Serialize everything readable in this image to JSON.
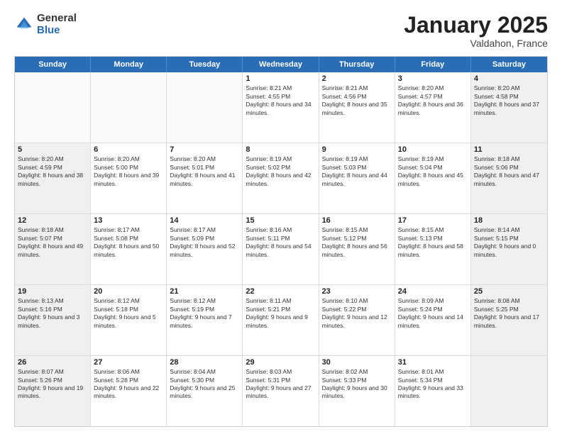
{
  "logo": {
    "general": "General",
    "blue": "Blue"
  },
  "header": {
    "month": "January 2025",
    "location": "Valdahon, France"
  },
  "weekdays": [
    "Sunday",
    "Monday",
    "Tuesday",
    "Wednesday",
    "Thursday",
    "Friday",
    "Saturday"
  ],
  "rows": [
    [
      {
        "day": "",
        "sunrise": "",
        "sunset": "",
        "daylight": "",
        "shaded": false,
        "empty": true
      },
      {
        "day": "",
        "sunrise": "",
        "sunset": "",
        "daylight": "",
        "shaded": false,
        "empty": true
      },
      {
        "day": "",
        "sunrise": "",
        "sunset": "",
        "daylight": "",
        "shaded": false,
        "empty": true
      },
      {
        "day": "1",
        "sunrise": "Sunrise: 8:21 AM",
        "sunset": "Sunset: 4:55 PM",
        "daylight": "Daylight: 8 hours and 34 minutes.",
        "shaded": false,
        "empty": false
      },
      {
        "day": "2",
        "sunrise": "Sunrise: 8:21 AM",
        "sunset": "Sunset: 4:56 PM",
        "daylight": "Daylight: 8 hours and 35 minutes.",
        "shaded": false,
        "empty": false
      },
      {
        "day": "3",
        "sunrise": "Sunrise: 8:20 AM",
        "sunset": "Sunset: 4:57 PM",
        "daylight": "Daylight: 8 hours and 36 minutes.",
        "shaded": false,
        "empty": false
      },
      {
        "day": "4",
        "sunrise": "Sunrise: 8:20 AM",
        "sunset": "Sunset: 4:58 PM",
        "daylight": "Daylight: 8 hours and 37 minutes.",
        "shaded": true,
        "empty": false
      }
    ],
    [
      {
        "day": "5",
        "sunrise": "Sunrise: 8:20 AM",
        "sunset": "Sunset: 4:59 PM",
        "daylight": "Daylight: 8 hours and 38 minutes.",
        "shaded": true,
        "empty": false
      },
      {
        "day": "6",
        "sunrise": "Sunrise: 8:20 AM",
        "sunset": "Sunset: 5:00 PM",
        "daylight": "Daylight: 8 hours and 39 minutes.",
        "shaded": false,
        "empty": false
      },
      {
        "day": "7",
        "sunrise": "Sunrise: 8:20 AM",
        "sunset": "Sunset: 5:01 PM",
        "daylight": "Daylight: 8 hours and 41 minutes.",
        "shaded": false,
        "empty": false
      },
      {
        "day": "8",
        "sunrise": "Sunrise: 8:19 AM",
        "sunset": "Sunset: 5:02 PM",
        "daylight": "Daylight: 8 hours and 42 minutes.",
        "shaded": false,
        "empty": false
      },
      {
        "day": "9",
        "sunrise": "Sunrise: 8:19 AM",
        "sunset": "Sunset: 5:03 PM",
        "daylight": "Daylight: 8 hours and 44 minutes.",
        "shaded": false,
        "empty": false
      },
      {
        "day": "10",
        "sunrise": "Sunrise: 8:19 AM",
        "sunset": "Sunset: 5:04 PM",
        "daylight": "Daylight: 8 hours and 45 minutes.",
        "shaded": false,
        "empty": false
      },
      {
        "day": "11",
        "sunrise": "Sunrise: 8:18 AM",
        "sunset": "Sunset: 5:06 PM",
        "daylight": "Daylight: 8 hours and 47 minutes.",
        "shaded": true,
        "empty": false
      }
    ],
    [
      {
        "day": "12",
        "sunrise": "Sunrise: 8:18 AM",
        "sunset": "Sunset: 5:07 PM",
        "daylight": "Daylight: 8 hours and 49 minutes.",
        "shaded": true,
        "empty": false
      },
      {
        "day": "13",
        "sunrise": "Sunrise: 8:17 AM",
        "sunset": "Sunset: 5:08 PM",
        "daylight": "Daylight: 8 hours and 50 minutes.",
        "shaded": false,
        "empty": false
      },
      {
        "day": "14",
        "sunrise": "Sunrise: 8:17 AM",
        "sunset": "Sunset: 5:09 PM",
        "daylight": "Daylight: 8 hours and 52 minutes.",
        "shaded": false,
        "empty": false
      },
      {
        "day": "15",
        "sunrise": "Sunrise: 8:16 AM",
        "sunset": "Sunset: 5:11 PM",
        "daylight": "Daylight: 8 hours and 54 minutes.",
        "shaded": false,
        "empty": false
      },
      {
        "day": "16",
        "sunrise": "Sunrise: 8:15 AM",
        "sunset": "Sunset: 5:12 PM",
        "daylight": "Daylight: 8 hours and 56 minutes.",
        "shaded": false,
        "empty": false
      },
      {
        "day": "17",
        "sunrise": "Sunrise: 8:15 AM",
        "sunset": "Sunset: 5:13 PM",
        "daylight": "Daylight: 8 hours and 58 minutes.",
        "shaded": false,
        "empty": false
      },
      {
        "day": "18",
        "sunrise": "Sunrise: 8:14 AM",
        "sunset": "Sunset: 5:15 PM",
        "daylight": "Daylight: 9 hours and 0 minutes.",
        "shaded": true,
        "empty": false
      }
    ],
    [
      {
        "day": "19",
        "sunrise": "Sunrise: 8:13 AM",
        "sunset": "Sunset: 5:16 PM",
        "daylight": "Daylight: 9 hours and 3 minutes.",
        "shaded": true,
        "empty": false
      },
      {
        "day": "20",
        "sunrise": "Sunrise: 8:12 AM",
        "sunset": "Sunset: 5:18 PM",
        "daylight": "Daylight: 9 hours and 5 minutes.",
        "shaded": false,
        "empty": false
      },
      {
        "day": "21",
        "sunrise": "Sunrise: 8:12 AM",
        "sunset": "Sunset: 5:19 PM",
        "daylight": "Daylight: 9 hours and 7 minutes.",
        "shaded": false,
        "empty": false
      },
      {
        "day": "22",
        "sunrise": "Sunrise: 8:11 AM",
        "sunset": "Sunset: 5:21 PM",
        "daylight": "Daylight: 9 hours and 9 minutes.",
        "shaded": false,
        "empty": false
      },
      {
        "day": "23",
        "sunrise": "Sunrise: 8:10 AM",
        "sunset": "Sunset: 5:22 PM",
        "daylight": "Daylight: 9 hours and 12 minutes.",
        "shaded": false,
        "empty": false
      },
      {
        "day": "24",
        "sunrise": "Sunrise: 8:09 AM",
        "sunset": "Sunset: 5:24 PM",
        "daylight": "Daylight: 9 hours and 14 minutes.",
        "shaded": false,
        "empty": false
      },
      {
        "day": "25",
        "sunrise": "Sunrise: 8:08 AM",
        "sunset": "Sunset: 5:25 PM",
        "daylight": "Daylight: 9 hours and 17 minutes.",
        "shaded": true,
        "empty": false
      }
    ],
    [
      {
        "day": "26",
        "sunrise": "Sunrise: 8:07 AM",
        "sunset": "Sunset: 5:26 PM",
        "daylight": "Daylight: 9 hours and 19 minutes.",
        "shaded": true,
        "empty": false
      },
      {
        "day": "27",
        "sunrise": "Sunrise: 8:06 AM",
        "sunset": "Sunset: 5:28 PM",
        "daylight": "Daylight: 9 hours and 22 minutes.",
        "shaded": false,
        "empty": false
      },
      {
        "day": "28",
        "sunrise": "Sunrise: 8:04 AM",
        "sunset": "Sunset: 5:30 PM",
        "daylight": "Daylight: 9 hours and 25 minutes.",
        "shaded": false,
        "empty": false
      },
      {
        "day": "29",
        "sunrise": "Sunrise: 8:03 AM",
        "sunset": "Sunset: 5:31 PM",
        "daylight": "Daylight: 9 hours and 27 minutes.",
        "shaded": false,
        "empty": false
      },
      {
        "day": "30",
        "sunrise": "Sunrise: 8:02 AM",
        "sunset": "Sunset: 5:33 PM",
        "daylight": "Daylight: 9 hours and 30 minutes.",
        "shaded": false,
        "empty": false
      },
      {
        "day": "31",
        "sunrise": "Sunrise: 8:01 AM",
        "sunset": "Sunset: 5:34 PM",
        "daylight": "Daylight: 9 hours and 33 minutes.",
        "shaded": false,
        "empty": false
      },
      {
        "day": "",
        "sunrise": "",
        "sunset": "",
        "daylight": "",
        "shaded": true,
        "empty": true
      }
    ]
  ]
}
